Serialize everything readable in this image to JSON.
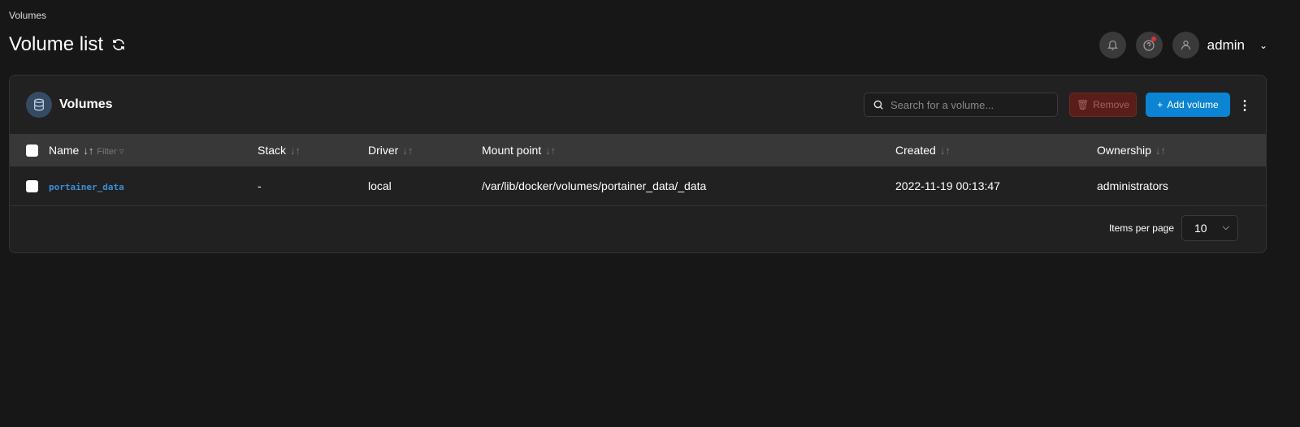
{
  "breadcrumb": "Volumes",
  "page_title": "Volume list",
  "header": {
    "user": "admin"
  },
  "card": {
    "title": "Volumes",
    "search_placeholder": "Search for a volume...",
    "remove_label": "Remove",
    "add_label": "Add volume"
  },
  "table": {
    "columns": [
      "Name",
      "Stack",
      "Driver",
      "Mount point",
      "Created",
      "Ownership"
    ],
    "filter_label": "Filter",
    "rows": [
      {
        "name": "portainer_data",
        "stack": "-",
        "driver": "local",
        "mount": "/var/lib/docker/volumes/portainer_data/_data",
        "created": "2022-11-19 00:13:47",
        "ownership": "administrators"
      }
    ]
  },
  "pagination": {
    "label": "Items per page",
    "value": "10"
  },
  "colors": {
    "accent": "#0b84d4",
    "link": "#3b8fd6",
    "danger": "#5a1d1a",
    "notification_dot": "#e03131"
  }
}
